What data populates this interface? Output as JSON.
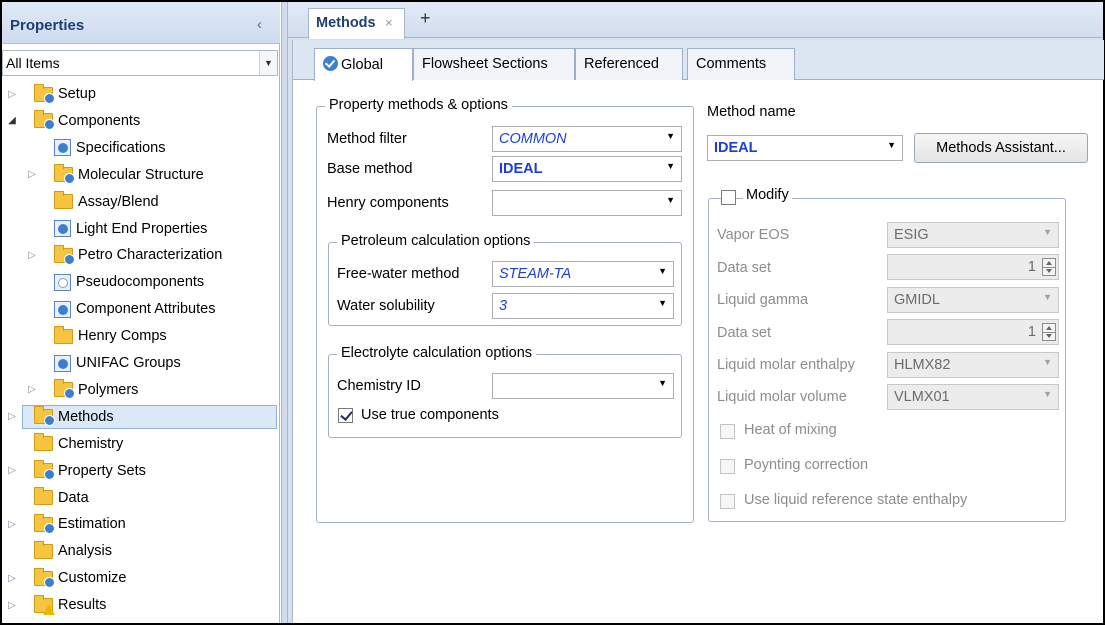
{
  "left_pane": {
    "title": "Properties",
    "collapse_glyph": "‹",
    "filter_value": "All Items",
    "tree": [
      {
        "label": "Setup",
        "icon": "folder-check-icon",
        "expander": "collapsed"
      },
      {
        "label": "Components",
        "icon": "folder-check-icon",
        "expander": "expanded"
      },
      {
        "label": "Specifications",
        "icon": "form-check-icon",
        "expander": "none"
      },
      {
        "label": "Molecular Structure",
        "icon": "folder-check-icon",
        "expander": "collapsed"
      },
      {
        "label": "Assay/Blend",
        "icon": "folder-icon",
        "expander": "none"
      },
      {
        "label": "Light End Properties",
        "icon": "form-check-icon",
        "expander": "none"
      },
      {
        "label": "Petro Characterization",
        "icon": "folder-check-icon",
        "expander": "collapsed"
      },
      {
        "label": "Pseudocomponents",
        "icon": "form-empty-icon",
        "expander": "none"
      },
      {
        "label": "Component Attributes",
        "icon": "form-check-icon",
        "expander": "none"
      },
      {
        "label": "Henry Comps",
        "icon": "folder-icon",
        "expander": "none"
      },
      {
        "label": "UNIFAC Groups",
        "icon": "form-check-icon",
        "expander": "none"
      },
      {
        "label": "Polymers",
        "icon": "folder-check-icon",
        "expander": "collapsed"
      },
      {
        "label": "Methods",
        "icon": "folder-check-icon",
        "expander": "collapsed",
        "selected": true
      },
      {
        "label": "Chemistry",
        "icon": "folder-icon",
        "expander": "none"
      },
      {
        "label": "Property Sets",
        "icon": "folder-check-icon",
        "expander": "collapsed"
      },
      {
        "label": "Data",
        "icon": "folder-icon",
        "expander": "none"
      },
      {
        "label": "Estimation",
        "icon": "folder-check-icon",
        "expander": "collapsed"
      },
      {
        "label": "Analysis",
        "icon": "folder-icon",
        "expander": "none"
      },
      {
        "label": "Customize",
        "icon": "folder-check-icon",
        "expander": "collapsed"
      },
      {
        "label": "Results",
        "icon": "folder-warning-icon",
        "expander": "collapsed"
      }
    ]
  },
  "doc_tab": {
    "label": "Methods",
    "close_glyph": "×",
    "add_glyph": "+"
  },
  "inner_tabs": [
    "Global",
    "Flowsheet Sections",
    "Referenced",
    "Comments"
  ],
  "property_methods": {
    "group_title": "Property methods & options",
    "method_filter_label": "Method filter",
    "method_filter_value": "COMMON",
    "base_method_label": "Base method",
    "base_method_value": "IDEAL",
    "henry_label": "Henry components",
    "henry_value": ""
  },
  "petroleum": {
    "group_title": "Petroleum calculation options",
    "free_water_label": "Free-water method",
    "free_water_value": "STEAM-TA",
    "water_solubility_label": "Water solubility",
    "water_solubility_value": "3"
  },
  "electrolyte": {
    "group_title": "Electrolyte calculation options",
    "chemistry_id_label": "Chemistry ID",
    "chemistry_id_value": "",
    "use_true_components_label": "Use true components",
    "use_true_components_checked": true
  },
  "method_name": {
    "label": "Method name",
    "value": "IDEAL",
    "assistant_button": "Methods Assistant..."
  },
  "modify": {
    "label": "Modify",
    "checked": false,
    "vapor_eos_label": "Vapor EOS",
    "vapor_eos_value": "ESIG",
    "data_set_label_1": "Data set",
    "data_set_value_1": "1",
    "liquid_gamma_label": "Liquid gamma",
    "liquid_gamma_value": "GMIDL",
    "data_set_label_2": "Data set",
    "data_set_value_2": "1",
    "liquid_molar_enthalpy_label": "Liquid molar enthalpy",
    "liquid_molar_enthalpy_value": "HLMX82",
    "liquid_molar_volume_label": "Liquid molar volume",
    "liquid_molar_volume_value": "VLMX01",
    "heat_of_mixing_label": "Heat of mixing",
    "poynting_label": "Poynting correction",
    "liquid_ref_label": "Use liquid reference state enthalpy"
  },
  "colors": {
    "accent_blue": "#1b3fd6",
    "header_navy": "#1e3f73",
    "selection": "#dbe8f7"
  }
}
